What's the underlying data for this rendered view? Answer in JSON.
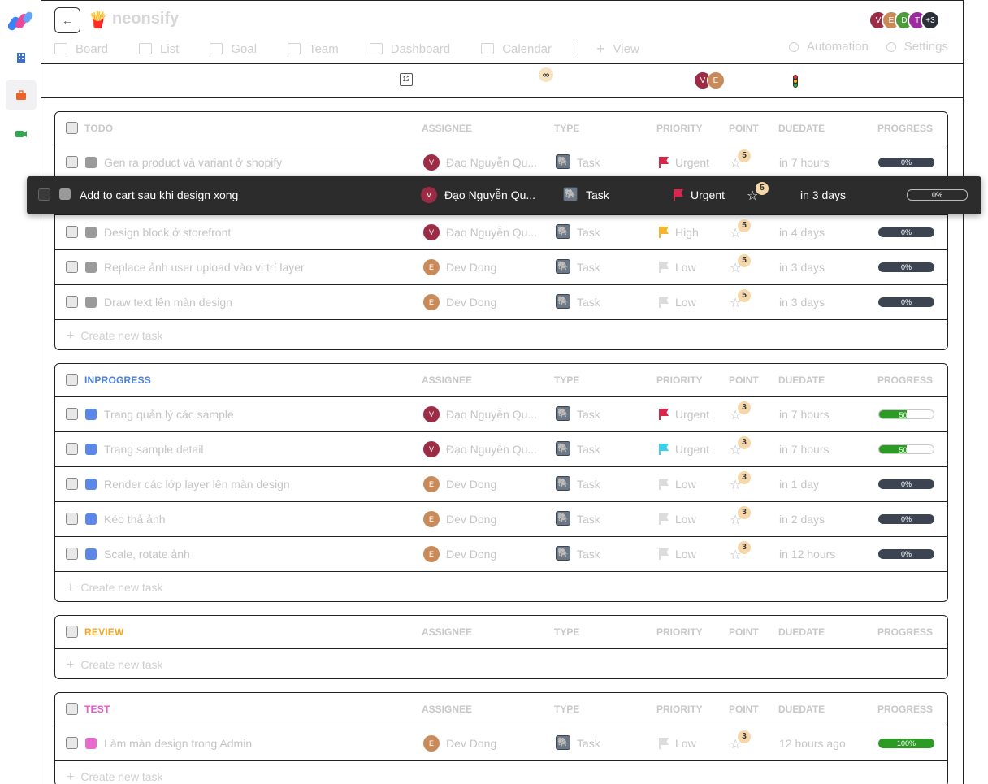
{
  "app": {
    "project_name": "neonsify",
    "project_icon": "🍟"
  },
  "header_avatars": [
    {
      "initial": "V",
      "color": "#9c2b45"
    },
    {
      "initial": "E",
      "color": "#c98a5a"
    },
    {
      "initial": "D",
      "color": "#4d9a3c"
    },
    {
      "initial": "T",
      "color": "#9c2ba0"
    },
    {
      "initial": "+3",
      "color": "#2b3038"
    }
  ],
  "tabs": [
    "Board",
    "List",
    "Goal",
    "Team",
    "Dashboard",
    "Calendar"
  ],
  "add_view_label": "View",
  "right_tabs": {
    "automation": "Automation",
    "settings": "Settings"
  },
  "filterbar": {
    "calendar_icon_text": "12",
    "infinity_text": "∞",
    "avatars": [
      {
        "initial": "V",
        "color": "#9c2b45"
      },
      {
        "initial": "E",
        "color": "#c98a5a"
      }
    ]
  },
  "columns": {
    "assignee": "ASSIGNEE",
    "type": "TYPE",
    "priority": "PRIORITY",
    "point": "POINT",
    "duedate": "DUEDATE",
    "progress": "PROGRESS"
  },
  "create_label": "Create new task",
  "groups": [
    {
      "name": "TODO",
      "color": "#c8c8c8",
      "square": "#9a9a9a",
      "tasks": [
        {
          "name": "Gen ra product và variant ở shopify",
          "assignee": "Đạo Nguyễn Qu...",
          "av": "V",
          "av_color": "#9c2b45",
          "type": "Task",
          "priority": "Urgent",
          "flag": "#d9264b",
          "point": "5",
          "due": "in 7 hours",
          "progress": "0%"
        },
        {
          "name": "Design block ở storefront",
          "assignee": "Đạo Nguyễn Qu...",
          "av": "V",
          "av_color": "#9c2b45",
          "type": "Task",
          "priority": "High",
          "flag": "#f5b52c",
          "point": "5",
          "due": "in 4 days",
          "progress": "0%"
        },
        {
          "name": "Replace ảnh user upload vào vị trí layer",
          "assignee": "Dev Dong",
          "av": "E",
          "av_color": "#c98a5a",
          "type": "Task",
          "priority": "Low",
          "flag": "#dcdcdc",
          "point": "5",
          "due": "in 3 days",
          "progress": "0%"
        },
        {
          "name": "Draw text lên màn design",
          "assignee": "Dev Dong",
          "av": "E",
          "av_color": "#c98a5a",
          "type": "Task",
          "priority": "Low",
          "flag": "#dcdcdc",
          "point": "5",
          "due": "in 3 days",
          "progress": "0%"
        }
      ]
    },
    {
      "name": "INPROGRESS",
      "color": "#4a7fe0",
      "square": "#5b87e8",
      "tasks": [
        {
          "name": "Trang quản lý các sample",
          "assignee": "Đạo Nguyễn Qu...",
          "av": "V",
          "av_color": "#9c2b45",
          "type": "Task",
          "priority": "Urgent",
          "flag": "#d9264b",
          "point": "3",
          "due": "in 7 hours",
          "progress": "50%",
          "progress_value": 0.5
        },
        {
          "name": "Trang sample detail",
          "assignee": "Đạo Nguyễn Qu...",
          "av": "V",
          "av_color": "#9c2b45",
          "type": "Task",
          "priority": "Urgent",
          "flag": "#3ad1e8",
          "point": "3",
          "due": "in 7 hours",
          "progress": "50%",
          "progress_value": 0.5
        },
        {
          "name": "Render các lớp layer lên màn design",
          "assignee": "Dev Dong",
          "av": "E",
          "av_color": "#c98a5a",
          "type": "Task",
          "priority": "Low",
          "flag": "#dcdcdc",
          "point": "3",
          "due": "in 1 day",
          "progress": "0%"
        },
        {
          "name": "Kéo thả ảnh",
          "assignee": "Dev Dong",
          "av": "E",
          "av_color": "#c98a5a",
          "type": "Task",
          "priority": "Low",
          "flag": "#dcdcdc",
          "point": "3",
          "due": "in 2 days",
          "progress": "0%"
        },
        {
          "name": "Scale, rotate ảnh",
          "assignee": "Dev Dong",
          "av": "E",
          "av_color": "#c98a5a",
          "type": "Task",
          "priority": "Low",
          "flag": "#dcdcdc",
          "point": "3",
          "due": "in 12 hours",
          "progress": "0%"
        }
      ]
    },
    {
      "name": "REVIEW",
      "color": "#f5a623",
      "square": "#f5a623",
      "tasks": []
    },
    {
      "name": "TEST",
      "color": "#e05cc8",
      "square": "#e86bd0",
      "tasks": [
        {
          "name": "Làm màn design trong Admin",
          "assignee": "Dev Dong",
          "av": "E",
          "av_color": "#c98a5a",
          "type": "Task",
          "priority": "Low",
          "flag": "#dcdcdc",
          "point": "3",
          "due": "12 hours ago",
          "progress": "100%",
          "progress_value": 1
        }
      ]
    }
  ],
  "dragged_task": {
    "name": "Add to cart sau khi design xong",
    "assignee": "Đạo Nguyễn Qu...",
    "av": "V",
    "av_color": "#9c2b45",
    "type": "Task",
    "priority": "Urgent",
    "flag": "#d9264b",
    "point": "5",
    "due": "in 3 days",
    "progress": "0%"
  },
  "colors": {
    "accent": "#2b3038",
    "progress_green": "#2e9a26"
  }
}
